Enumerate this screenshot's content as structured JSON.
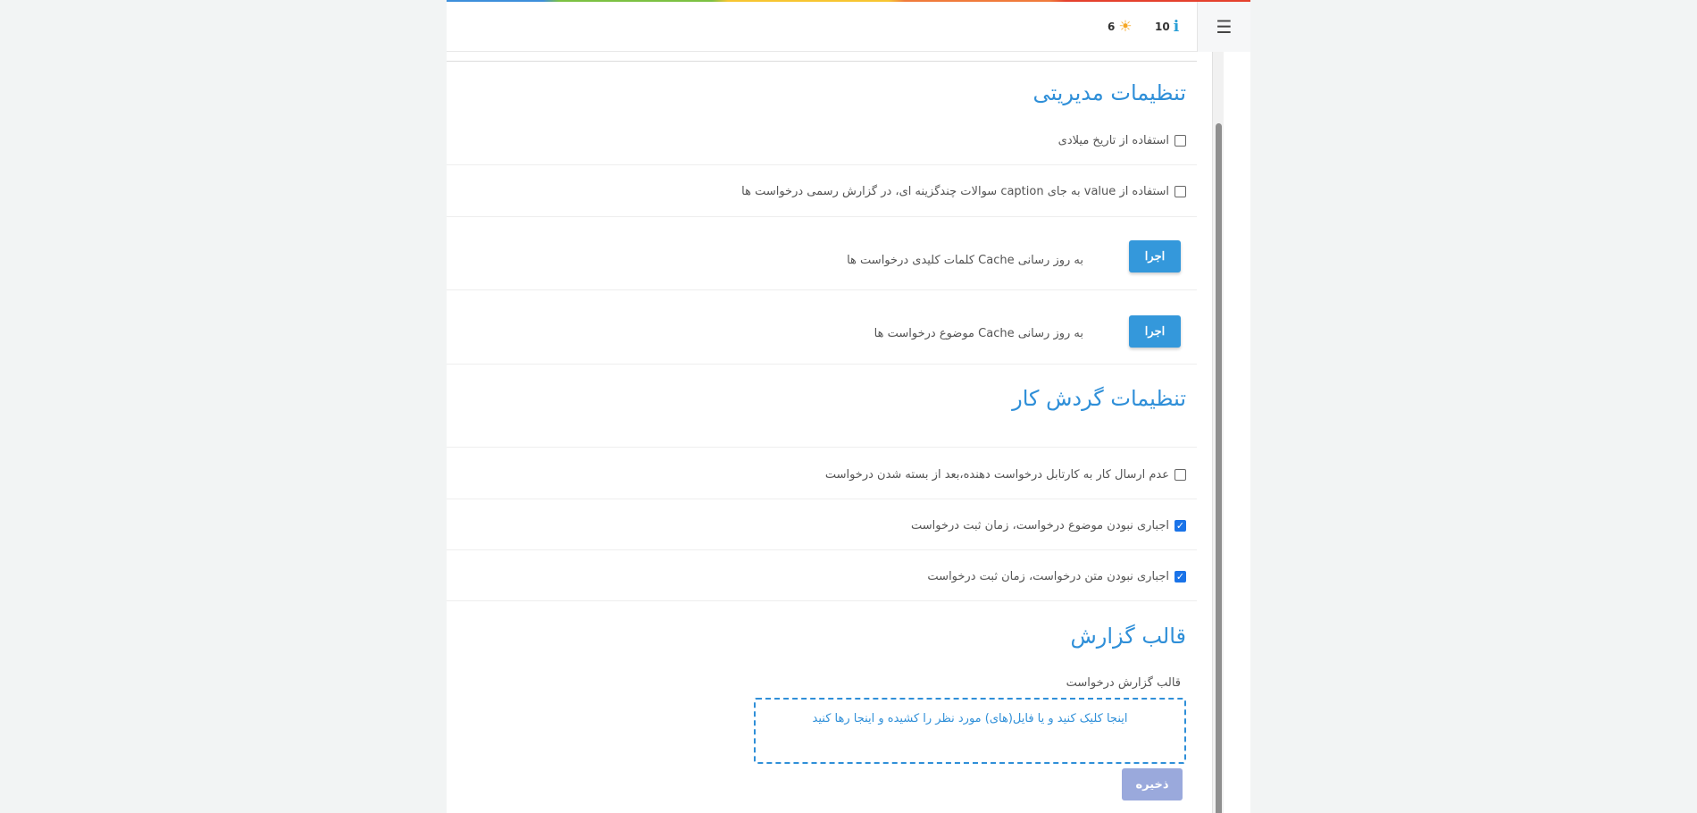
{
  "header": {
    "menu_icon": "hamburger-icon",
    "info_count": "10",
    "weather_count": "6"
  },
  "sections": {
    "admin": {
      "title": "تنظیمات مدیریتی",
      "use_gregorian_label": "استفاده از تاریخ میلادی",
      "use_gregorian_checked": false,
      "use_value_label": "استفاده از value به جای caption سوالات چندگزینه ای، در گزارش رسمی درخواست ها",
      "use_value_checked": false,
      "cache_keywords_label": "به روز رسانی Cache کلمات کلیدی درخواست ها",
      "cache_keywords_button": "اجرا",
      "cache_subject_label": "به روز رسانی Cache موضوع درخواست ها",
      "cache_subject_button": "اجرا"
    },
    "workflow": {
      "title": "تنظیمات گردش کار",
      "no_cartable_label": "عدم ارسال کار به کارتابل درخواست دهنده،بعد از بسته شدن درخواست",
      "no_cartable_checked": false,
      "optional_subject_label": "اجباری نبودن موضوع درخواست، زمان ثبت درخواست",
      "optional_subject_checked": true,
      "optional_text_label": "اجباری نبودن متن درخواست، زمان ثبت درخواست",
      "optional_text_checked": true
    },
    "report": {
      "title": "قالب گزارش",
      "template_label": "قالب گزارش درخواست",
      "dropzone_text": "اینجا کلیک کنید و یا فایل(های) مورد نظر را کشیده و اینجا رها کنید",
      "save_button": "ذخیره"
    }
  },
  "colors": {
    "accent": "#2f8fd8",
    "button": "#3498db",
    "save_button": "#9aa9dc",
    "checkbox_checked": "#1a73e8"
  }
}
